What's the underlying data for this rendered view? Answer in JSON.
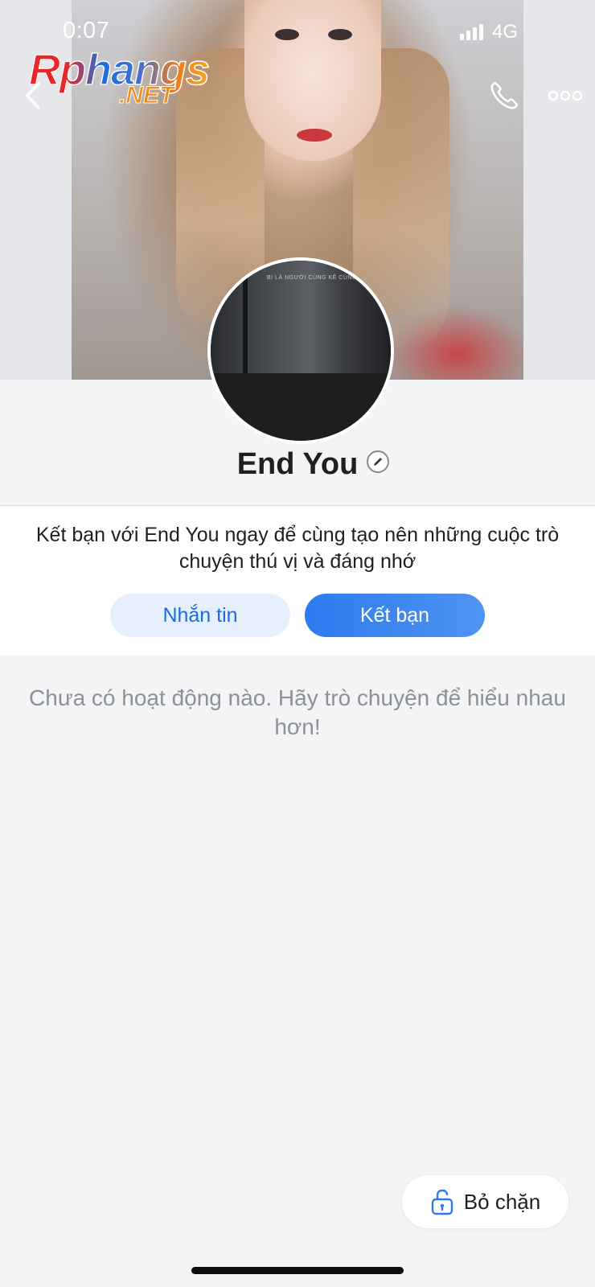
{
  "status_bar": {
    "time": "0:07",
    "network": "4G"
  },
  "watermark": {
    "main": "Rphangs",
    "sub": ".NET"
  },
  "header": {
    "back_icon": "chevron-left-icon",
    "call_icon": "phone-icon",
    "more_icon": "more-dots-icon"
  },
  "avatar": {
    "caption": "BI LÀ NGƯỜI CÙNG KÊ CÙNG EM"
  },
  "profile": {
    "name": "End You",
    "edit_icon": "pencil-icon"
  },
  "invite": {
    "text": "Kết bạn với End You ngay để cùng tạo nên những cuộc trò chuyện thú vị và đáng nhớ",
    "message_button": "Nhắn tin",
    "add_friend_button": "Kết bạn"
  },
  "activity": {
    "empty_text": "Chưa có hoạt động nào. Hãy trò chuyện để hiểu nhau hơn!"
  },
  "unblock": {
    "label": "Bỏ chặn",
    "icon": "unlock-icon"
  },
  "colors": {
    "accent": "#2d7bef",
    "accent_light": "#e6f0fd",
    "background": "#f3f4f5"
  }
}
